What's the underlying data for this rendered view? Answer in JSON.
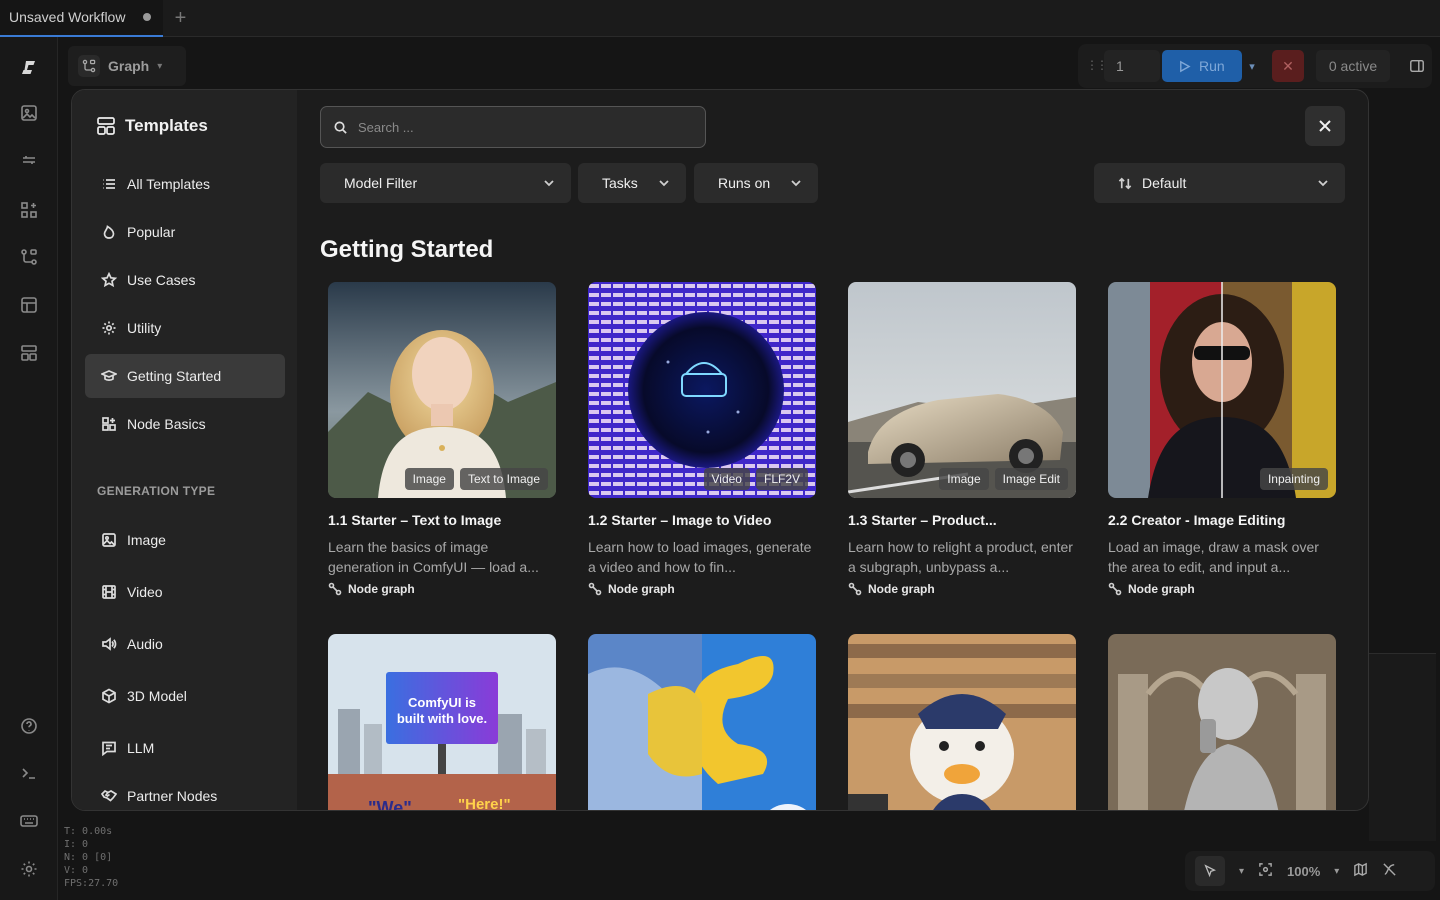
{
  "tabs": [
    {
      "label": "Unsaved Workflow"
    }
  ],
  "graph": {
    "label": "Graph"
  },
  "toolbar": {
    "queue_count": "1",
    "run_label": "Run",
    "active_label": "0 active"
  },
  "stats": [
    "T: 0.00s",
    "I: 0",
    "N: 0 [0]",
    "V: 0",
    "FPS:27.70"
  ],
  "zoom": "100%",
  "modal": {
    "title": "Templates",
    "nav": [
      {
        "label": "All Templates",
        "icon": "list-icon"
      },
      {
        "label": "Popular",
        "icon": "flame-icon"
      },
      {
        "label": "Use Cases",
        "icon": "star-icon"
      },
      {
        "label": "Utility",
        "icon": "gear-icon"
      },
      {
        "label": "Getting Started",
        "icon": "graduation-cap-icon",
        "active": true
      },
      {
        "label": "Node Basics",
        "icon": "puzzle-icon"
      }
    ],
    "section_label": "GENERATION TYPE",
    "gen_types": [
      {
        "label": "Image",
        "icon": "image-icon"
      },
      {
        "label": "Video",
        "icon": "film-icon"
      },
      {
        "label": "Audio",
        "icon": "speaker-icon"
      },
      {
        "label": "3D Model",
        "icon": "cube-icon"
      },
      {
        "label": "LLM",
        "icon": "chat-icon"
      },
      {
        "label": "Partner Nodes",
        "icon": "handshake-icon"
      }
    ],
    "search": {
      "placeholder": "Search ..."
    },
    "filters": {
      "model": "Model Filter",
      "tasks": "Tasks",
      "runs_on": "Runs on",
      "sort": "Default"
    },
    "section_title": "Getting Started",
    "cards": [
      {
        "title": "1.1 Starter – Text to Image",
        "desc": "Learn the basics of image generation in ComfyUI — load a...",
        "tags": [
          "Image",
          "Text to Image"
        ],
        "meta": "Node graph"
      },
      {
        "title": "1.2 Starter – Image to Video",
        "desc": "Learn how to load images, generate a video and how to fin...",
        "tags": [
          "Video",
          "FLF2V"
        ],
        "meta": "Node graph"
      },
      {
        "title": "1.3 Starter – Product...",
        "desc": "Learn how to relight a product, enter a subgraph, unbypass a...",
        "tags": [
          "Image",
          "Image Edit"
        ],
        "meta": "Node graph"
      },
      {
        "title": "2.2 Creator - Image Editing",
        "desc": "Load an image, draw a mask over the area to edit, and input a...",
        "tags": [
          "Inpainting"
        ],
        "meta": "Node graph"
      }
    ],
    "row2": {
      "billboard_line1": "ComfyUI is",
      "billboard_line2": "built with love.",
      "graffiti1": "\"We\"",
      "graffiti2": "\"Here!\""
    }
  }
}
